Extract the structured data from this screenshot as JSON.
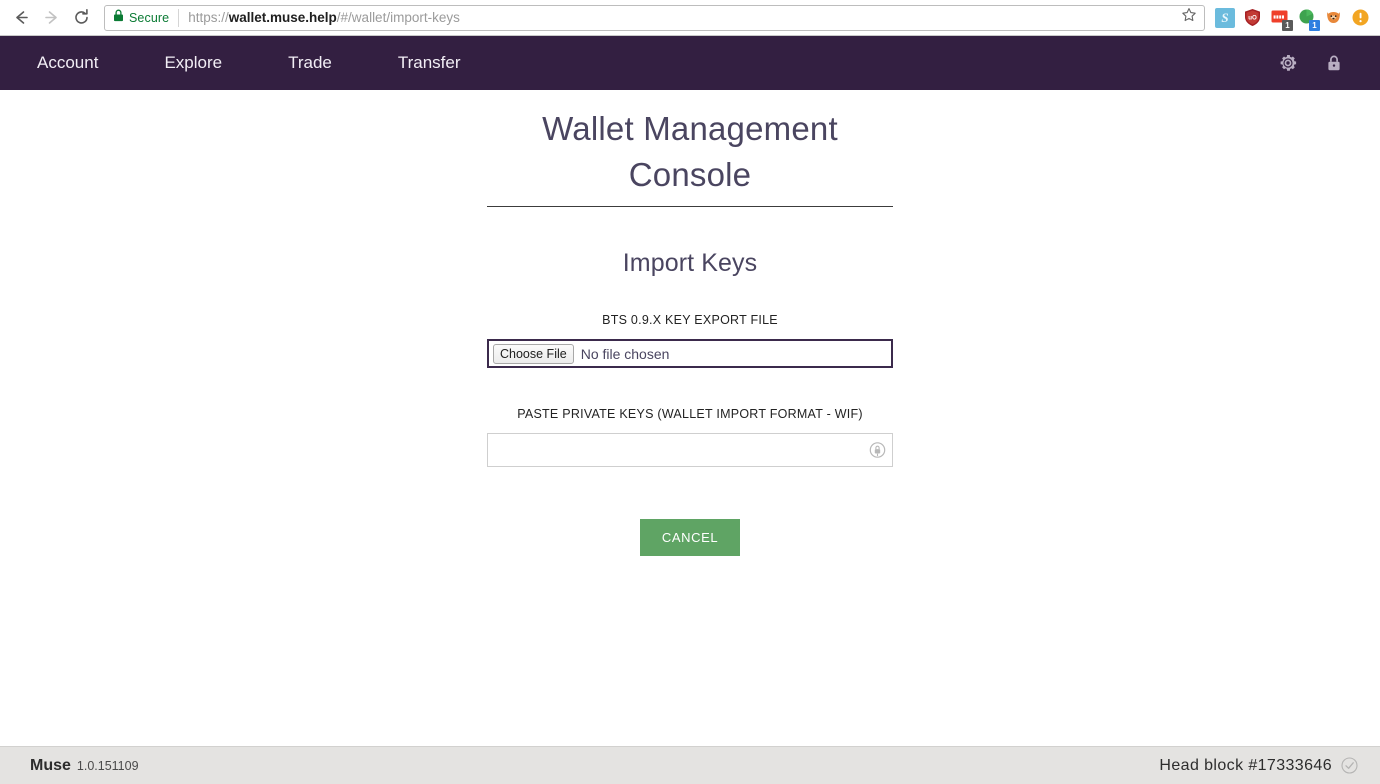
{
  "browser": {
    "back_icon": "back-arrow-icon",
    "forward_icon": "forward-arrow-icon",
    "reload_icon": "reload-icon",
    "security_badge": "Secure",
    "url_scheme": "https://",
    "url_host": "wallet.muse.help",
    "url_path": "/#/wallet/import-keys",
    "url_full": "https://wallet.muse.help/#/wallet/import-keys",
    "bookmark_icon": "star-icon",
    "extensions": [
      {
        "name": "steem-extension-icon",
        "glyph": "S",
        "badge": ""
      },
      {
        "name": "ublock-origin-icon",
        "glyph": "uO",
        "badge": ""
      },
      {
        "name": "red-extension-icon",
        "glyph": "",
        "badge": "1"
      },
      {
        "name": "green-extension-icon",
        "glyph": "",
        "badge": "1"
      },
      {
        "name": "fox-extension-icon",
        "glyph": "🦊",
        "badge": ""
      },
      {
        "name": "alert-extension-icon",
        "glyph": "!",
        "badge": ""
      }
    ]
  },
  "appnav": {
    "background": "#331f41",
    "items": [
      {
        "label": "Account",
        "name": "nav-item-account"
      },
      {
        "label": "Explore",
        "name": "nav-item-explore"
      },
      {
        "label": "Trade",
        "name": "nav-item-trade"
      },
      {
        "label": "Transfer",
        "name": "nav-item-transfer"
      }
    ],
    "settings_icon": "gear-icon",
    "lock_icon": "lock-icon"
  },
  "main": {
    "page_title": "Wallet Management Console",
    "section_title": "Import Keys",
    "file_field": {
      "label": "BTS 0.9.X Key Export File",
      "button_label": "Choose File",
      "status_text": "No file chosen",
      "border_color": "#3b2a4c"
    },
    "keys_field": {
      "label": "Paste Private Keys (Wallet Import Format - WIF)",
      "value": "",
      "placeholder": "",
      "addon_icon": "password-manager-icon"
    },
    "cancel_button": {
      "label": "Cancel",
      "color": "#5fa464"
    }
  },
  "footer": {
    "brand": "Muse",
    "version": "1.0.151109",
    "head_block": "Head block #17333646",
    "status_icon": "check-circle-icon"
  }
}
